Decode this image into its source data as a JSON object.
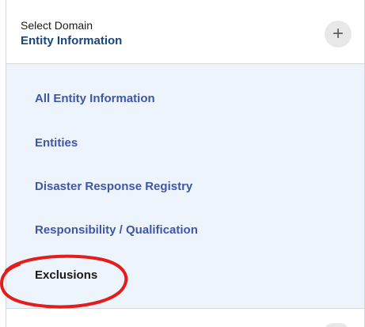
{
  "domain_select": {
    "label": "Select Domain",
    "current": "Entity Information",
    "toggle_symbol": "+"
  },
  "menu": {
    "items": [
      {
        "label": "All Entity Information"
      },
      {
        "label": "Entities"
      },
      {
        "label": "Disaster Response Registry"
      },
      {
        "label": "Responsibility / Qualification"
      },
      {
        "label": "Exclusions"
      }
    ]
  },
  "annotation": {
    "shape": "ellipse",
    "color": "#e11d1d",
    "target": "Exclusions"
  }
}
